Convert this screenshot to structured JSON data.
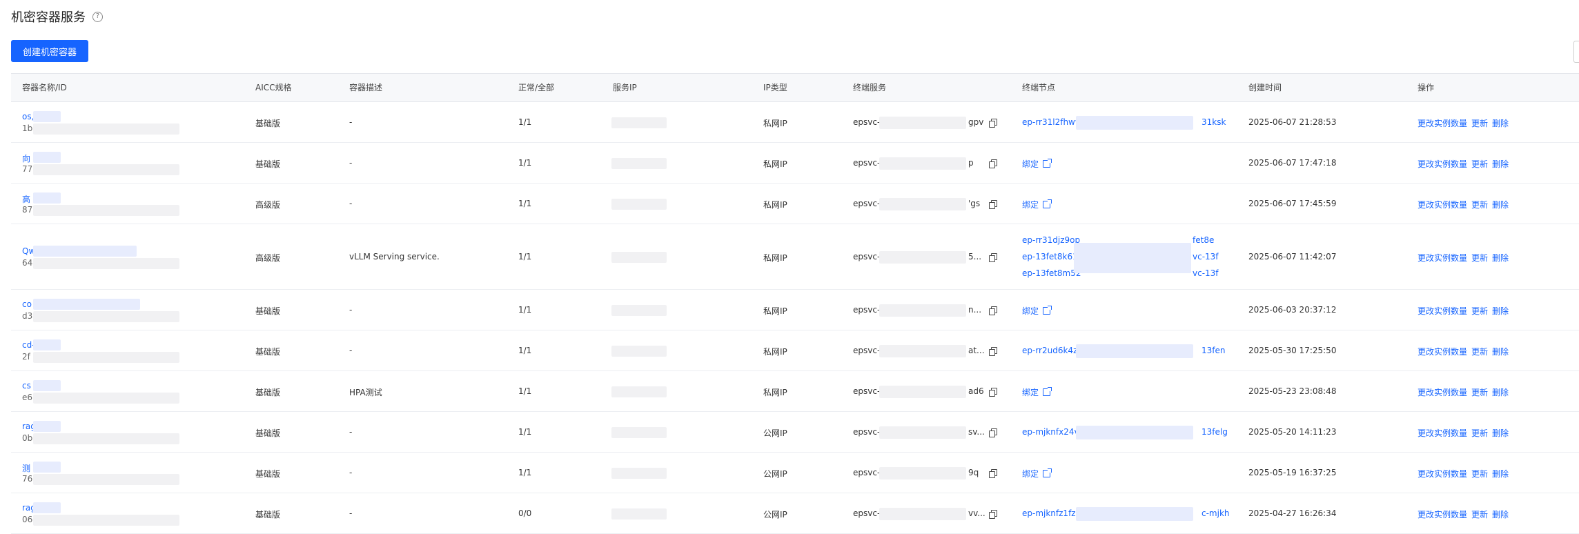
{
  "header": {
    "title": "机密容器服务",
    "help_icon": "?"
  },
  "toolbar": {
    "create_label": "创建机密容器"
  },
  "table": {
    "columns": [
      "容器名称/ID",
      "AICC规格",
      "容器描述",
      "正常/全部",
      "服务IP",
      "IP类型",
      "终端服务",
      "终端节点",
      "创建时间",
      "操作"
    ],
    "actions": {
      "scale": "更改实例数量",
      "update": "更新",
      "delete": "删除"
    },
    "bind_label": "绑定",
    "rows": [
      {
        "name": "os,",
        "id": "1b",
        "spec": "基础版",
        "desc": "-",
        "count": "1/1",
        "ip_type": "私网IP",
        "svc_prefix": "epsvc-",
        "svc_suffix": "gpv",
        "ep1": "ep-rr31l2fhww",
        "ep2": "31ksk",
        "created": "2025-06-07 21:28:53"
      },
      {
        "name": "向",
        "id": "77",
        "spec": "基础版",
        "desc": "-",
        "count": "1/1",
        "ip_type": "私网IP",
        "svc_prefix": "epsvc-",
        "svc_suffix": "p",
        "created": "2025-06-07 17:47:18"
      },
      {
        "name": "高",
        "id": "87",
        "spec": "高级版",
        "desc": "-",
        "count": "1/1",
        "ip_type": "私网IP",
        "svc_prefix": "epsvc-",
        "svc_suffix": "'gs",
        "created": "2025-06-07 17:45:59"
      },
      {
        "name": "Qw",
        "id": "64",
        "spec": "高级版",
        "desc": "vLLM Serving service.",
        "count": "1/1",
        "ip_type": "私网IP",
        "svc_prefix": "epsvc-",
        "svc_suffix": "5...",
        "eps": [
          {
            "a": "ep-rr31djz9op",
            "b": "fet8e"
          },
          {
            "a": "ep-13fet8k61r",
            "b": "vc-13f"
          },
          {
            "a": "ep-13fet8m52",
            "b": "vc-13f"
          }
        ],
        "created": "2025-06-07 11:42:07"
      },
      {
        "name": "co",
        "id": "d3",
        "spec": "基础版",
        "desc": "-",
        "count": "1/1",
        "ip_type": "私网IP",
        "svc_prefix": "epsvc-",
        "svc_suffix": "n...",
        "created": "2025-06-03 20:37:12"
      },
      {
        "name": "cd-",
        "id": "2f",
        "spec": "基础版",
        "desc": "-",
        "count": "1/1",
        "ip_type": "私网IP",
        "svc_prefix": "epsvc-",
        "svc_suffix": "at...",
        "ep1": "ep-rr2ud6k4zb",
        "ep2": "13fen",
        "created": "2025-05-30 17:25:50"
      },
      {
        "name": "cs",
        "id": "e6",
        "spec": "基础版",
        "desc": "HPA测试",
        "count": "1/1",
        "ip_type": "私网IP",
        "svc_prefix": "epsvc-",
        "svc_suffix": "ad6",
        "created": "2025-05-23 23:08:48"
      },
      {
        "name": "rag",
        "id": "0b",
        "spec": "基础版",
        "desc": "-",
        "count": "1/1",
        "ip_type": "公网IP",
        "svc_prefix": "epsvc-",
        "svc_suffix": "sv...",
        "ep1": "ep-mjknfx24vl",
        "ep2": "13felg",
        "created": "2025-05-20 14:11:23"
      },
      {
        "name": "测",
        "id": "76",
        "spec": "基础版",
        "desc": "-",
        "count": "1/1",
        "ip_type": "公网IP",
        "svc_prefix": "epsvc-",
        "svc_suffix": "9q",
        "created": "2025-05-19 16:37:25"
      },
      {
        "name": "rag",
        "id": "06",
        "spec": "基础版",
        "desc": "-",
        "count": "0/0",
        "ip_type": "公网IP",
        "svc_prefix": "epsvc-",
        "svc_suffix": "vv...",
        "ep1": "ep-mjknfz1fz8",
        "ep2": "c-mjkh",
        "created": "2025-04-27 16:26:34"
      }
    ]
  },
  "colors": {
    "primary": "#1664ff",
    "header_bg": "#f7f8fa",
    "border": "#e4e6eb"
  }
}
